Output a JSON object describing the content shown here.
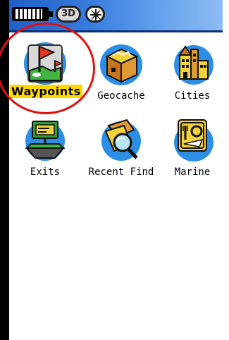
{
  "status_bar": {
    "battery_icon": "battery-icon",
    "gps_mode_label": "3D",
    "satellite_icon": "satellite-icon",
    "accent_color": "#3a7ee0"
  },
  "menu": {
    "selected_index": 0,
    "items": [
      {
        "label": "Waypoints",
        "icon": "waypoint-flag-icon",
        "selected": true
      },
      {
        "label": "Geocache",
        "icon": "treasure-chest-icon",
        "selected": false
      },
      {
        "label": "Cities",
        "icon": "city-buildings-icon",
        "selected": false
      },
      {
        "label": "Exits",
        "icon": "highway-exit-icon",
        "selected": false
      },
      {
        "label": "Recent Find",
        "icon": "recent-find-magnifier-icon",
        "selected": false
      },
      {
        "label": "Marine",
        "icon": "marine-service-icon",
        "selected": false
      }
    ]
  },
  "annotation": {
    "highlight_color": "#e01010"
  }
}
